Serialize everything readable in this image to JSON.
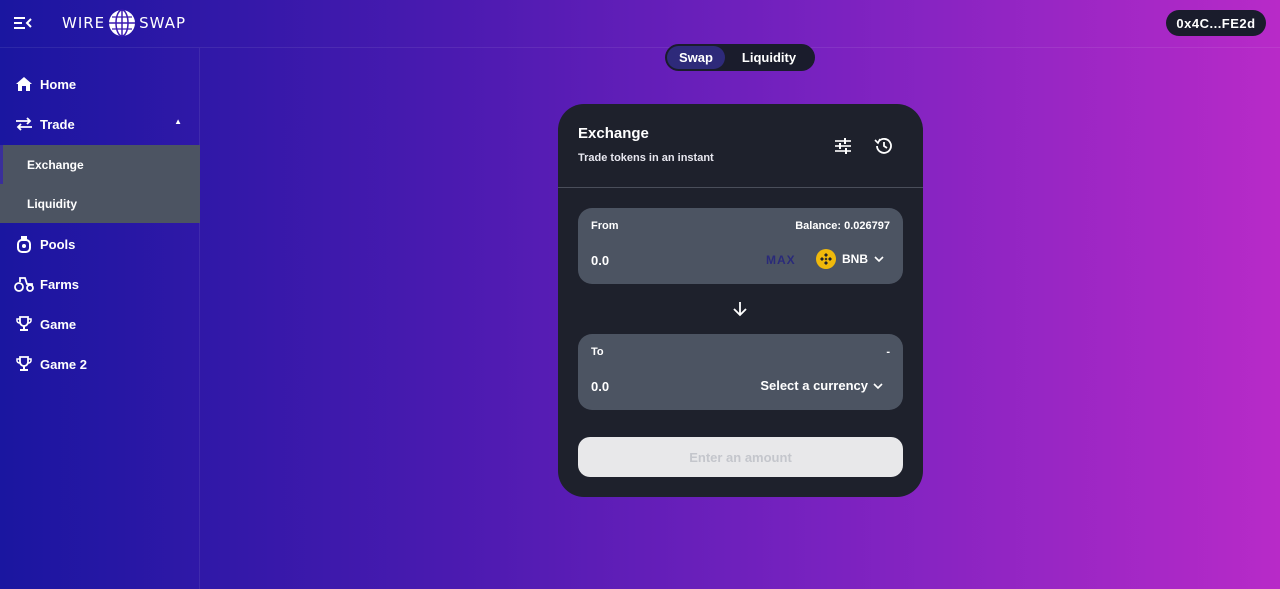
{
  "header": {
    "logo_left": "WIRE",
    "logo_right": "SWAP",
    "wallet": "0x4C...FE2d"
  },
  "sidebar": {
    "items": [
      {
        "label": "Home",
        "icon": "home-icon"
      },
      {
        "label": "Trade",
        "icon": "swap-arrows-icon"
      },
      {
        "label": "Pools",
        "icon": "pool-icon"
      },
      {
        "label": "Farms",
        "icon": "tractor-icon"
      },
      {
        "label": "Game",
        "icon": "trophy-icon"
      },
      {
        "label": "Game 2",
        "icon": "trophy-icon"
      }
    ],
    "trade_submenu": [
      "Exchange",
      "Liquidity"
    ]
  },
  "tabs": {
    "swap": "Swap",
    "liquidity": "Liquidity"
  },
  "card": {
    "title": "Exchange",
    "subtitle": "Trade tokens in an instant",
    "from": {
      "label": "From",
      "balance": "Balance: 0.026797",
      "amount": "0.0",
      "max": "MAX",
      "token": "BNB"
    },
    "to": {
      "label": "To",
      "right": "-",
      "amount": "0.0",
      "select": "Select a currency"
    },
    "submit": "Enter an amount"
  },
  "colors": {
    "accent": "#2e2a7a",
    "card_bg": "#1e212c",
    "panel_bg": "#4c5462",
    "bnb": "#f0b90b"
  }
}
